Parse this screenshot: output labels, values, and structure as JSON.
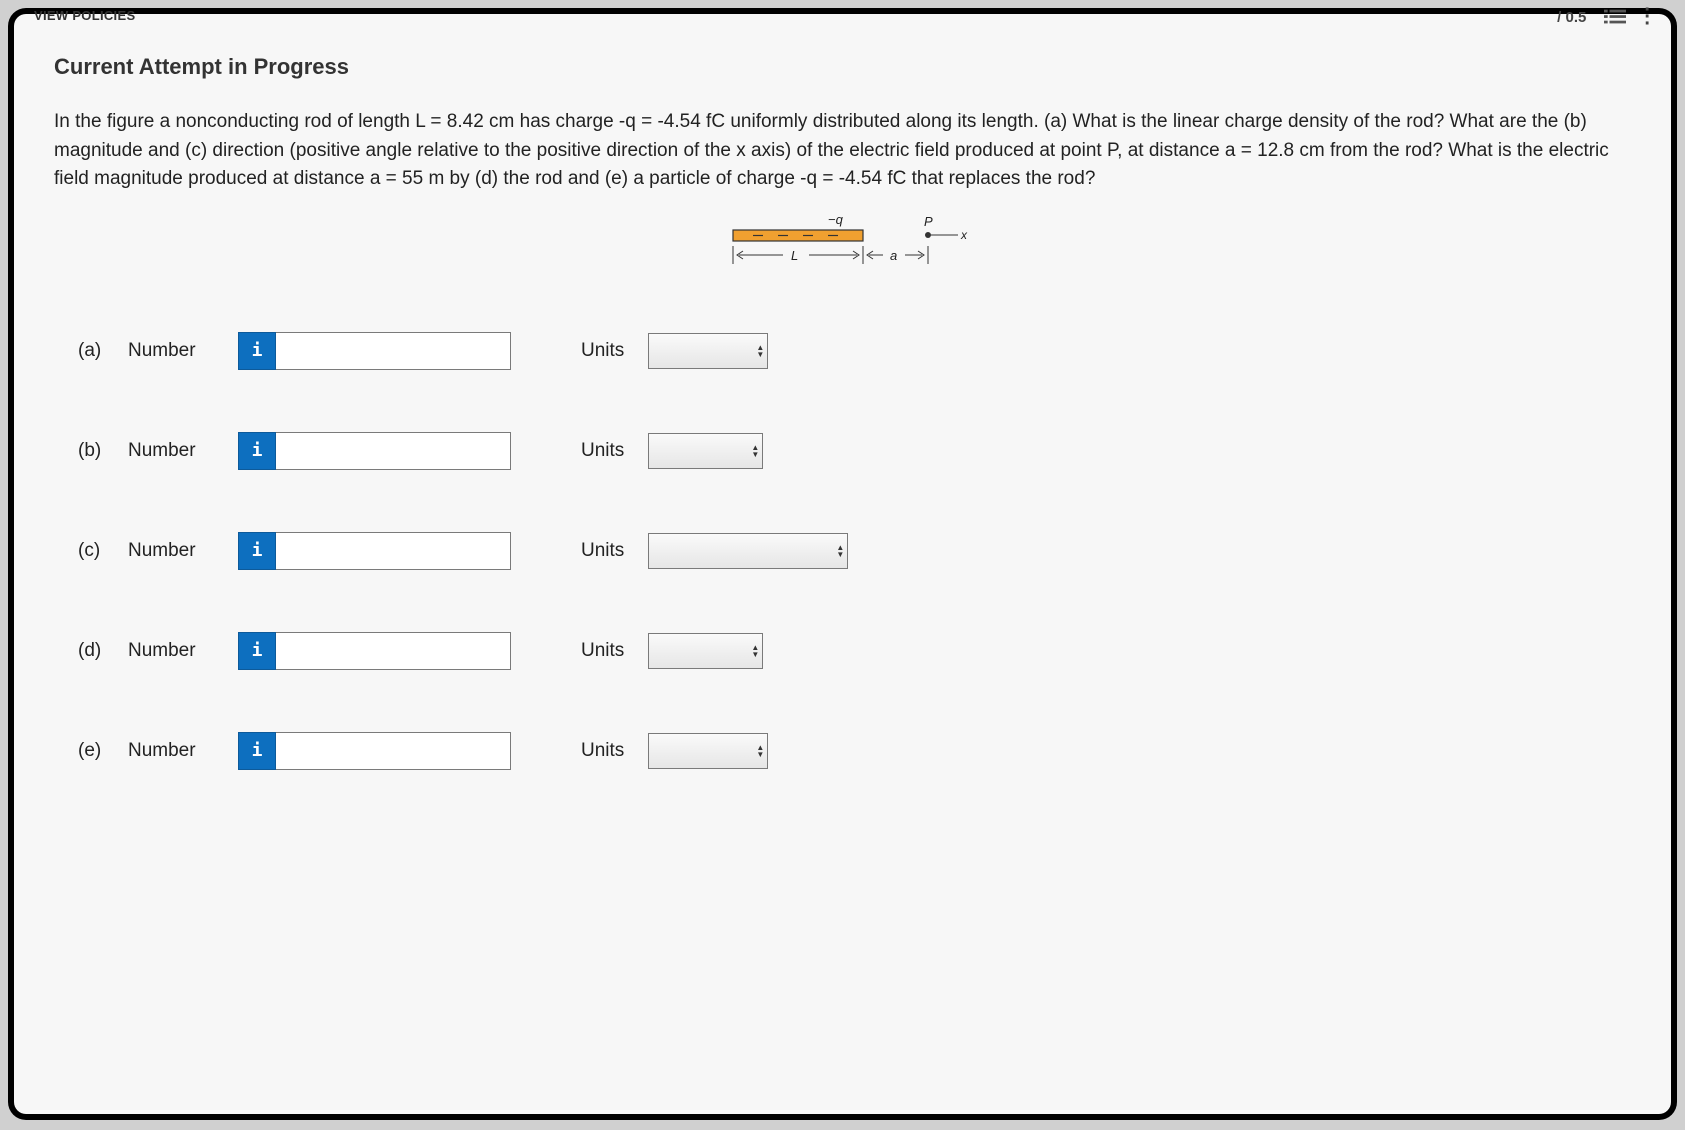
{
  "top": {
    "policies": "VIEW POLICIES",
    "score": "/ 0.5"
  },
  "heading": "Current Attempt in Progress",
  "problem": "In the figure a nonconducting rod of length L = 8.42 cm has charge -q = -4.54 fC uniformly distributed along its length. (a) What is the linear charge density of the rod? What are the (b) magnitude and (c) direction (positive angle relative to the positive direction of the x axis) of the electric field produced at point P, at distance a = 12.8 cm from the rod? What is the electric field magnitude produced at distance a = 55 m by (d) the rod and (e) a particle of charge -q = -4.54 fC that replaces the rod?",
  "diagram": {
    "q": "−q",
    "L": "L",
    "a": "a",
    "P": "P",
    "x": "x"
  },
  "rows": [
    {
      "part": "(a)",
      "number": "Number",
      "units": "Units",
      "value": "",
      "uval": "",
      "uw": "w-sm"
    },
    {
      "part": "(b)",
      "number": "Number",
      "units": "Units",
      "value": "",
      "uval": "",
      "uw": "w-md"
    },
    {
      "part": "(c)",
      "number": "Number",
      "units": "Units",
      "value": "",
      "uval": "",
      "uw": "w-lg"
    },
    {
      "part": "(d)",
      "number": "Number",
      "units": "Units",
      "value": "",
      "uval": "",
      "uw": "w-md"
    },
    {
      "part": "(e)",
      "number": "Number",
      "units": "Units",
      "value": "",
      "uval": "",
      "uw": "w-sm"
    }
  ],
  "info_icon": "i"
}
